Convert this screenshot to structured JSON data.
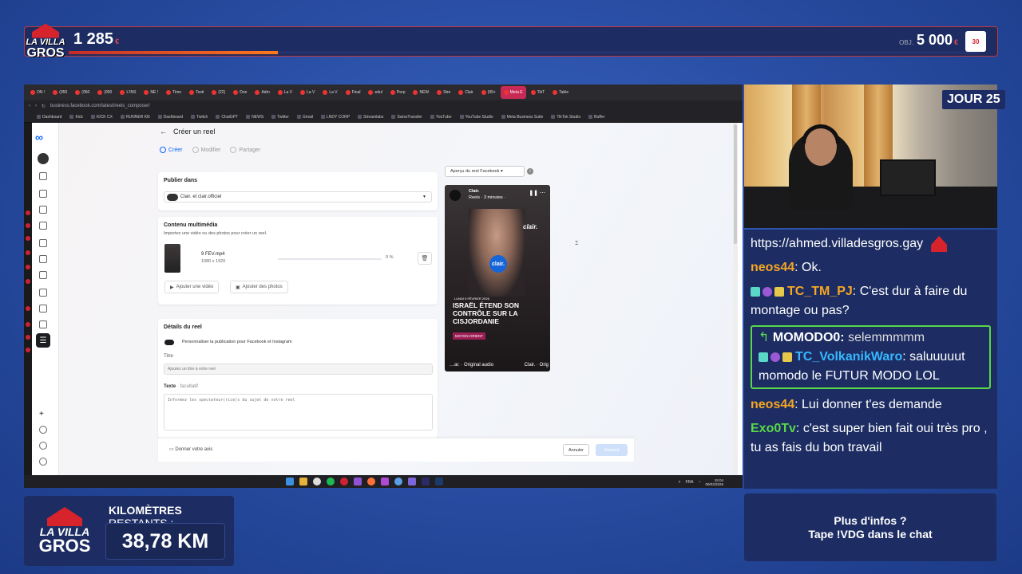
{
  "overlay": {
    "logo_line1": "LA VILLA",
    "logo_line2": "GROS",
    "counter_left": "1 285",
    "counter_left_unit": "€",
    "progress_fraction": 0.23,
    "objective_label": "OBJ.",
    "objective_value": "5 000",
    "objective_unit": "€",
    "right_logo_text": "30",
    "day_badge": "JOUR 25",
    "km_title_bold": "KILOMÈTRES",
    "km_title_rest": " RESTANTS :",
    "km_value": "38,78 KM",
    "info_line1": "Plus d'infos ?",
    "info_line2": "Tape !VDG dans le chat"
  },
  "browser": {
    "tabs": [
      "ON !",
      "(950",
      "(950",
      "(950",
      "L'INS",
      "NE !",
      "Time",
      "Texti",
      "(22)",
      "Don",
      "Adm",
      "La V",
      "La V",
      "La V",
      "Final",
      "edul",
      "Perp",
      "NEW",
      "Stre",
      "Clair",
      "(99+",
      "Meta E",
      "TikT",
      "Table"
    ],
    "active_tab_index": 21,
    "url": "business.facebook.com/latest/reels_composer/",
    "bookmarks": [
      "Dashboard",
      "Kick",
      "KICK CX",
      "RUNNER KN",
      "Dashboard",
      "Twitch",
      "ChatGPT",
      "NEWS",
      "Twitter",
      "Gmail",
      "LNDY CORP",
      "Streamlabs",
      "SwissTransfer",
      "YouTube",
      "YouTube Studio",
      "Meta Business Suite",
      "TikTok Studio",
      "Buffer"
    ]
  },
  "composer": {
    "title": "Créer un reel",
    "steps": [
      "Créer",
      "Modifier",
      "Partager"
    ],
    "publish_in_label": "Publier dans",
    "publish_in_value": "Clair. et clair.officiel",
    "media_title": "Contenu multimédia",
    "media_sub": "Importez une vidéo ou des photos pour créer un reel.",
    "file_name": "9 FEV.mp4",
    "file_dims": "1080 x 1920",
    "upload_percent_label": "0 %",
    "upload_fraction": 0,
    "add_video": "Ajouter une vidéo",
    "add_photos": "Ajouter des photos",
    "details_title": "Détails du reel",
    "customize_label": "Personnaliser la publication pour Facebook et Instagram",
    "title_label": "Titre",
    "title_placeholder": "Ajoutez un titre à votre reel",
    "text_label": "Texte",
    "text_optional": "· facultatif",
    "text_placeholder": "Informez les spectateur(rice)s du sujet de votre reel",
    "feedback": "Donner votre avis",
    "cancel": "Annuler",
    "next": "Suivant",
    "preview_select": "Aperçu du reel Facebook"
  },
  "preview": {
    "page_name": "Clair.",
    "meta": "Reels · 3 minutes · ",
    "brand": "clair.",
    "mic_text": "clair.",
    "date": "LUNDI 9 FÉVRIER 2026",
    "headline": "ISRAËL ÉTEND SON CONTRÔLE SUR LA CISJORDANIE",
    "tag": "MOYEN-ORIENT",
    "audio": "…ar. · Original audio",
    "audio_right": "Clair. · Orig"
  },
  "taskbar": {
    "lang": "FRA",
    "time": "15:04",
    "date": "09/02/2026"
  },
  "chat": {
    "link": "https://ahmed.villadesgros.gay",
    "messages": [
      {
        "nick": "neos44",
        "color": "#f5a623",
        "text": "Ok."
      },
      {
        "nick": "TC_TM_PJ",
        "color": "#f5a623",
        "text": "C'est dur à faire du montage ou pas?"
      },
      {
        "nick": "neos44",
        "color": "#f5a623",
        "text": "Lui donner t'es demande"
      },
      {
        "nick": "Exo0Tv",
        "color": "#59d84a",
        "text": "c'est super bien fait oui très pro , tu as fais du bon travail"
      }
    ],
    "reply": {
      "ref_nick": "MOMODO0:",
      "ref_text": "selemmmmm",
      "nick": "TC_VolkanikWaro",
      "color": "#37b7ff",
      "text": "saluuuuut momodo le FUTUR MODO LOL"
    }
  }
}
